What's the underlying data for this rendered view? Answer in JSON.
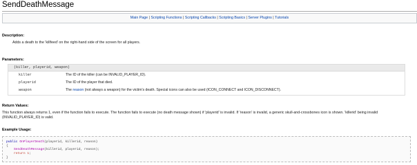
{
  "page": {
    "title": "SendDeathMessage"
  },
  "nav": {
    "links": [
      "Main Page",
      "Scripting Functions",
      "Scripting Callbacks",
      "Scripting Basics",
      "Server Plugins",
      "Tutorials"
    ],
    "separator": "|"
  },
  "description": {
    "heading": "Description:",
    "text": "Adds a death to the 'killfeed' on the right-hand side of the screen for all players."
  },
  "parameters": {
    "heading": "Parameters:",
    "signature": "(killer, playerid, weapon)",
    "rows": [
      {
        "name": "killer",
        "desc": "The ID of the killer (can be INVALID_PLAYER_ID)."
      },
      {
        "name": "playerid",
        "desc": "The ID of the player that died."
      },
      {
        "name": "weapon",
        "desc_pre": "The ",
        "desc_link": "reason",
        "desc_post": " (not always a weapon) for the victim's death. Special icons can also be used (ICON_CONNECT and ICON_DISCONNECT)."
      }
    ]
  },
  "return_values": {
    "heading": "Return Values:",
    "text1": "This function always returns 1, even if the function fails to execute. The function fails to execute (no death message shown) if 'playerid' is invalid. If 'reason' is invalid, a generic skull-and-crossbones icon is shown. 'killerid' being invalid",
    "text2": "(INVALID_PLAYER_ID) is valid."
  },
  "example": {
    "heading": "Example Usage:",
    "line1_kw": "public",
    "line1_fn": "OnPlayerDeath",
    "line1_rest": "(playerid, killerid, reason)",
    "line2": "{",
    "line3_fn": "SendDeathMessage",
    "line3_rest": "(killerid, playerid, reason);",
    "line4_kw": "return",
    "line4_num": "1",
    "line4_end": ";",
    "line5": "}"
  },
  "colors": {
    "link": "#0645ad",
    "code_keyword": "#0000aa",
    "code_function": "#aa00aa",
    "code_number": "#c0392b"
  }
}
